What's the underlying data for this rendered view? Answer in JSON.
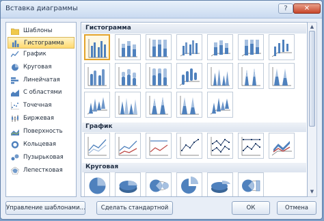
{
  "window": {
    "title": "Вставка диаграммы"
  },
  "sidebar": {
    "items": [
      {
        "label": "Шаблоны",
        "icon": "folder-icon"
      },
      {
        "label": "Гистограмма",
        "icon": "column-chart-icon",
        "selected": true
      },
      {
        "label": "График",
        "icon": "line-chart-icon"
      },
      {
        "label": "Круговая",
        "icon": "pie-chart-icon"
      },
      {
        "label": "Линейчатая",
        "icon": "bar-chart-icon"
      },
      {
        "label": "С областями",
        "icon": "area-chart-icon"
      },
      {
        "label": "Точечная",
        "icon": "scatter-chart-icon"
      },
      {
        "label": "Биржевая",
        "icon": "stock-chart-icon"
      },
      {
        "label": "Поверхность",
        "icon": "surface-chart-icon"
      },
      {
        "label": "Кольцевая",
        "icon": "doughnut-chart-icon"
      },
      {
        "label": "Пузырьковая",
        "icon": "bubble-chart-icon"
      },
      {
        "label": "Лепестковая",
        "icon": "radar-chart-icon"
      }
    ]
  },
  "sections": [
    {
      "label": "Гистограмма"
    },
    {
      "label": "График"
    },
    {
      "label": "Круговая"
    }
  ],
  "buttons": {
    "manage_templates": "Управление шаблонами...",
    "set_default": "Сделать стандартной",
    "ok": "ОК",
    "cancel": "Отмена"
  },
  "colors": {
    "accent": "#4f81bd",
    "selection": "#ffd96f"
  }
}
